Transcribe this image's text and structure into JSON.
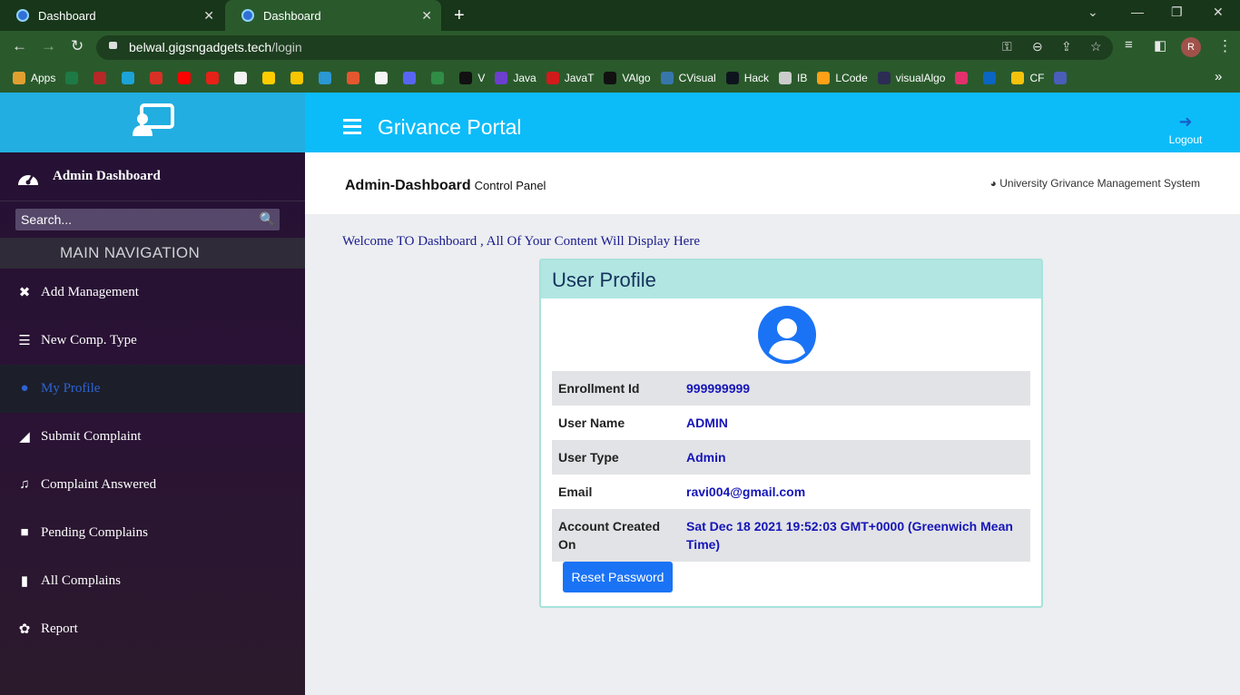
{
  "browser": {
    "tabs": [
      {
        "label": "Dashboard"
      },
      {
        "label": "Dashboard"
      }
    ],
    "url_host": "belwal.gigsngadgets.tech",
    "url_path": "/login",
    "profile_initial": "R",
    "bookmarks": [
      {
        "label": "Apps",
        "color": "#e0a030"
      },
      {
        "label": "",
        "color": "#1e7a45"
      },
      {
        "label": "",
        "color": "#b42828"
      },
      {
        "label": "",
        "color": "#1ca3d8"
      },
      {
        "label": "",
        "color": "#d93025"
      },
      {
        "label": "",
        "color": "#ff0000"
      },
      {
        "label": "",
        "color": "#e62117"
      },
      {
        "label": "",
        "color": "#f3f3f3"
      },
      {
        "label": "",
        "color": "#ffcc00"
      },
      {
        "label": "",
        "color": "#f7c600"
      },
      {
        "label": "",
        "color": "#2b98d3"
      },
      {
        "label": "",
        "color": "#e4572e"
      },
      {
        "label": "",
        "color": "#f5f5f5"
      },
      {
        "label": "",
        "color": "#5865f2"
      },
      {
        "label": "",
        "color": "#2f8d46"
      },
      {
        "label": "V",
        "color": "#111111"
      },
      {
        "label": "Java",
        "color": "#6c3fcf"
      },
      {
        "label": "JavaT",
        "color": "#d11b1b"
      },
      {
        "label": "VAlgo",
        "color": "#111111"
      },
      {
        "label": "CVisual",
        "color": "#3776ab"
      },
      {
        "label": "Hack",
        "color": "#0e141e"
      },
      {
        "label": "IB",
        "color": "#cccccc"
      },
      {
        "label": "LCode",
        "color": "#ffa116"
      },
      {
        "label": "visualAlgo",
        "color": "#2c2c54"
      },
      {
        "label": "",
        "color": "#e1306c"
      },
      {
        "label": "",
        "color": "#0a66c2"
      },
      {
        "label": "CF",
        "color": "#f4c20d"
      },
      {
        "label": "",
        "color": "#4a5eb8"
      }
    ],
    "more": "»"
  },
  "sidebar": {
    "heading": "Admin Dashboard",
    "search_placeholder": "Search...",
    "section_label": "MAIN NAVIGATION",
    "items": [
      {
        "label": "Add Management",
        "icon": "✖"
      },
      {
        "label": "New Comp. Type",
        "icon": "☰"
      },
      {
        "label": "My Profile",
        "icon": "●"
      },
      {
        "label": "Submit Complaint",
        "icon": "◢"
      },
      {
        "label": "Complaint Answered",
        "icon": "♫"
      },
      {
        "label": "Pending Complains",
        "icon": "■"
      },
      {
        "label": "All Complains",
        "icon": "▮"
      },
      {
        "label": "Report",
        "icon": "✿"
      }
    ]
  },
  "header": {
    "title": "Grivance Portal",
    "logout_label": "Logout"
  },
  "content": {
    "title": "Admin-Dashboard",
    "subtitle": "Control Panel",
    "system_name": "University Grivance Management System",
    "welcome": "Welcome TO Dashboard , All Of Your Content Will Display Here"
  },
  "profile": {
    "heading": "User Profile",
    "rows": [
      {
        "label": "Enrollment Id",
        "value": "999999999"
      },
      {
        "label": "User Name",
        "value": "ADMIN"
      },
      {
        "label": "User Type",
        "value": "Admin"
      },
      {
        "label": "Email",
        "value": "ravi004@gmail.com"
      },
      {
        "label": "Account Created On",
        "value": "Sat Dec 18 2021 19:52:03 GMT+0000 (Greenwich Mean Time)"
      }
    ],
    "reset_button": "Reset Password"
  },
  "colors": {
    "header_bg": "#0cbcf9",
    "sidebar_bg": "#241133",
    "active_item": "#2d63d3",
    "button_blue": "#1a73f5",
    "card_border": "#a8e2dc"
  }
}
